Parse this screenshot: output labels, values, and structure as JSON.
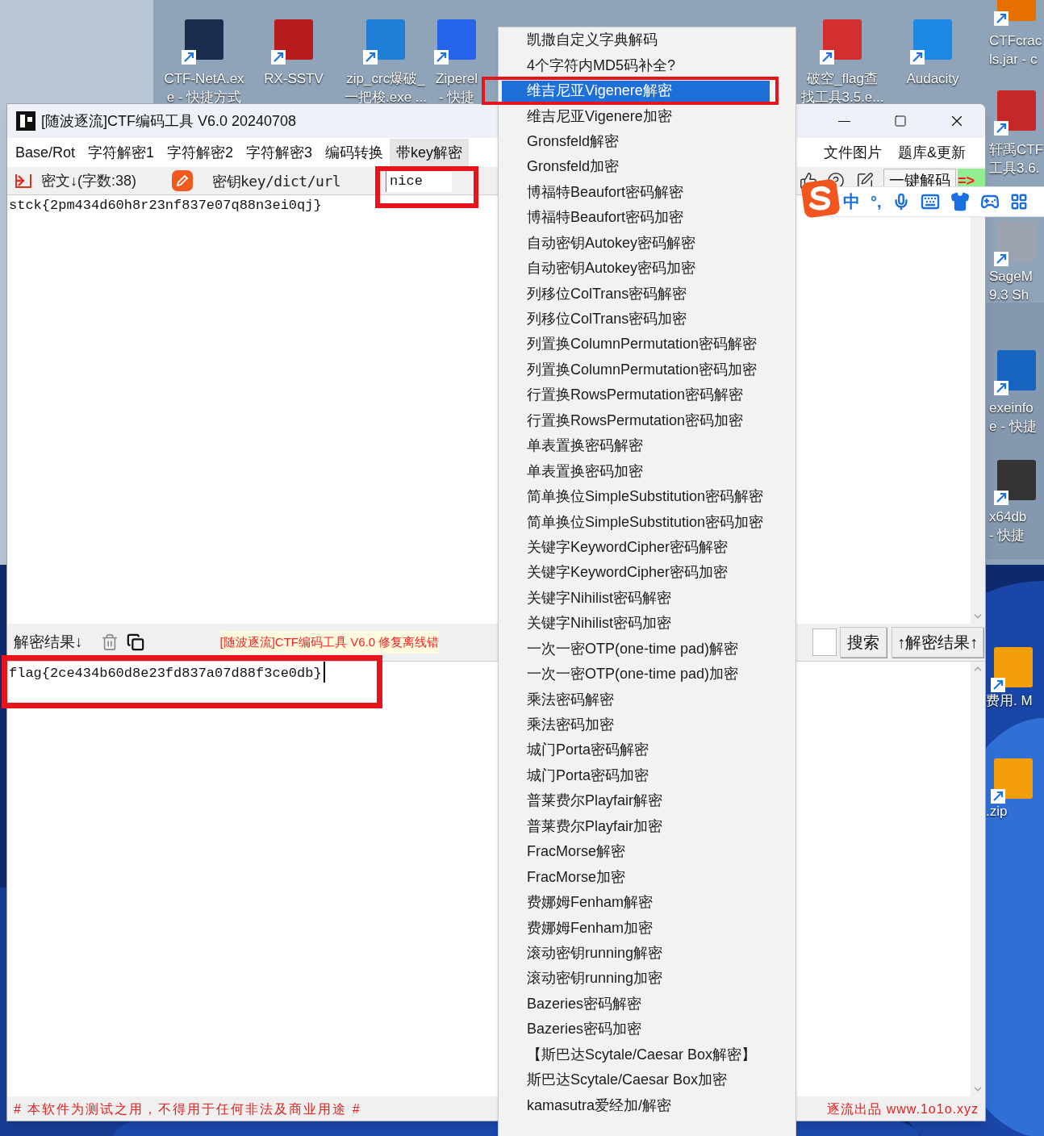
{
  "desktop_icons": [
    {
      "label": [
        "CTF-NetA.ex",
        "e - 快捷方式"
      ],
      "color": "#1b2d4f"
    },
    {
      "label": [
        "RX-SSTV"
      ],
      "color": "#b91c1c"
    },
    {
      "label": [
        "zip_crc爆破_",
        "一把梭.exe ..."
      ],
      "color": "#1f7fd6"
    },
    {
      "label": [
        "Ziperel",
        "- 快捷"
      ],
      "color": "#2563eb"
    },
    {
      "label": [
        "破空_flag查",
        "找工具3.5.e..."
      ],
      "color": "#d32f2f"
    },
    {
      "label": [
        "Audacity"
      ],
      "color": "#1e88e5"
    },
    {
      "label": [
        "CTFcrac",
        "ls.jar - c"
      ],
      "color": "#e76f00"
    },
    {
      "label": [
        "轩禹CTF",
        "工具3.6."
      ],
      "color": "#c62828"
    },
    {
      "label": [
        "SageM",
        "9.3 Sh"
      ],
      "color": "#9ca3af"
    },
    {
      "label": [
        "exeinfo",
        "e - 快捷"
      ],
      "color": "#1565c0"
    },
    {
      "label": [
        "x64db",
        "- 快捷"
      ],
      "color": "#333333"
    },
    {
      "label": [
        "费用.  M"
      ],
      "color": "#f59e0b"
    },
    {
      "label": [
        ".zip"
      ],
      "color": "#f59e0b"
    }
  ],
  "window": {
    "title": "[随波逐流]CTF编码工具 V6.0 20240708"
  },
  "menubar": {
    "left": [
      {
        "label": "Base/Rot",
        "selected": false
      },
      {
        "label": "字符解密1",
        "selected": false
      },
      {
        "label": "字符解密2",
        "selected": false
      },
      {
        "label": "字符解密3",
        "selected": false
      },
      {
        "label": "编码转换",
        "selected": false
      },
      {
        "label": "带key解密",
        "selected": true
      }
    ],
    "right": [
      {
        "label": "文件图片",
        "selected": false
      },
      {
        "label": "题库&更新",
        "selected": false
      }
    ]
  },
  "toolbar": {
    "cipher_label": "密文↓(字数:38)",
    "key_label": "密钥key/dict/url",
    "key_value": "nice",
    "decode_button": "一键解码",
    "arrow_label": "=>"
  },
  "ime_bar": {
    "mode": "中",
    "punctuation": "°,"
  },
  "input_text": "stck{2pm434d60h8r23nf837e07q88n3ei0qj}",
  "result_bar": {
    "label": "解密结果↓",
    "marquee": "[随波逐流]CTF编码工具 V6.0 修复离线错",
    "search_button": "搜索",
    "result_button": "↑解密结果↑"
  },
  "output_text": "flag{2ce434b60d8e23fd837a07d88f3ce0db}",
  "status_bar": {
    "notice": "# 本软件为测试之用，不得用于任何非法及商业用途 #",
    "credit": "逐流出品 www.1o1o.xyz"
  },
  "popup_menu": {
    "items": [
      {
        "label": "凯撒自定义字典解码",
        "selected": false
      },
      {
        "label": "4个字符内MD5码补全?",
        "selected": false
      },
      {
        "label": "维吉尼亚Vigenere解密",
        "selected": true
      },
      {
        "label": "维吉尼亚Vigenere加密",
        "selected": false
      },
      {
        "label": "Gronsfeld解密",
        "selected": false
      },
      {
        "label": "Gronsfeld加密",
        "selected": false
      },
      {
        "label": "博福特Beaufort密码解密",
        "selected": false
      },
      {
        "label": "博福特Beaufort密码加密",
        "selected": false
      },
      {
        "label": "自动密钥Autokey密码解密",
        "selected": false
      },
      {
        "label": "自动密钥Autokey密码加密",
        "selected": false
      },
      {
        "label": "列移位ColTrans密码解密",
        "selected": false
      },
      {
        "label": "列移位ColTrans密码加密",
        "selected": false
      },
      {
        "label": "列置换ColumnPermutation密码解密",
        "selected": false
      },
      {
        "label": "列置换ColumnPermutation密码加密",
        "selected": false
      },
      {
        "label": "行置换RowsPermutation密码解密",
        "selected": false
      },
      {
        "label": "行置换RowsPermutation密码加密",
        "selected": false
      },
      {
        "label": "单表置换密码解密",
        "selected": false
      },
      {
        "label": "单表置换密码加密",
        "selected": false
      },
      {
        "label": "简单换位SimpleSubstitution密码解密",
        "selected": false
      },
      {
        "label": "简单换位SimpleSubstitution密码加密",
        "selected": false
      },
      {
        "label": "关键字KeywordCipher密码解密",
        "selected": false
      },
      {
        "label": "关键字KeywordCipher密码加密",
        "selected": false
      },
      {
        "label": "关键字Nihilist密码解密",
        "selected": false
      },
      {
        "label": "关键字Nihilist密码加密",
        "selected": false
      },
      {
        "label": "一次一密OTP(one-time pad)解密",
        "selected": false
      },
      {
        "label": "一次一密OTP(one-time pad)加密",
        "selected": false
      },
      {
        "label": "乘法密码解密",
        "selected": false
      },
      {
        "label": "乘法密码加密",
        "selected": false
      },
      {
        "label": "城门Porta密码解密",
        "selected": false
      },
      {
        "label": "城门Porta密码加密",
        "selected": false
      },
      {
        "label": "普莱费尔Playfair解密",
        "selected": false
      },
      {
        "label": "普莱费尔Playfair加密",
        "selected": false
      },
      {
        "label": "FracMorse解密",
        "selected": false
      },
      {
        "label": "FracMorse加密",
        "selected": false
      },
      {
        "label": "费娜姆Fenham解密",
        "selected": false
      },
      {
        "label": "费娜姆Fenham加密",
        "selected": false
      },
      {
        "label": "滚动密钥running解密",
        "selected": false
      },
      {
        "label": "滚动密钥running加密",
        "selected": false
      },
      {
        "label": "Bazeries密码解密",
        "selected": false
      },
      {
        "label": "Bazeries密码加密",
        "selected": false
      },
      {
        "label": "【斯巴达Scytale/Caesar Box解密】",
        "selected": false
      },
      {
        "label": "斯巴达Scytale/Caesar Box加密",
        "selected": false
      },
      {
        "label": "kamasutra爱经加/解密",
        "selected": false
      }
    ]
  }
}
